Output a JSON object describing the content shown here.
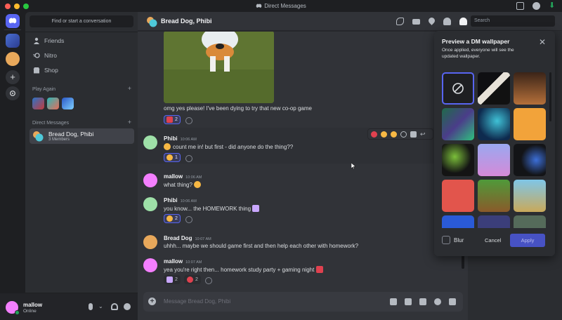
{
  "titlebar": {
    "title": "Direct Messages"
  },
  "sidebar": {
    "find_placeholder": "Find or start a conversation",
    "nav": [
      {
        "label": "Friends",
        "icon": "friends-icon"
      },
      {
        "label": "Nitro",
        "icon": "nitro-icon"
      },
      {
        "label": "Shop",
        "icon": "shop-icon"
      }
    ],
    "play_again_label": "Play Again",
    "direct_messages_label": "Direct Messages",
    "dm": {
      "name": "Bread Dog, Phibi",
      "subtitle": "3 Members"
    }
  },
  "user": {
    "name": "mallow",
    "status": "Online"
  },
  "header": {
    "title": "Bread Dog, Phibi",
    "search_placeholder": "Search"
  },
  "messages": [
    {
      "text": "omg yes please! I've been dying to try that new co-op game",
      "reactions": [
        {
          "emoji": "heart",
          "count": "2"
        }
      ]
    },
    {
      "author": "Phibi",
      "time": "10:06 AM",
      "text": "count me in! but first - did anyone do the thing??",
      "reactions": [
        {
          "emoji": "thinking",
          "count": "1"
        }
      ]
    },
    {
      "author": "mallow",
      "time": "10:06 AM",
      "text": "what thing?"
    },
    {
      "author": "Phibi",
      "time": "10:06 AM",
      "text": "you know... the HOMEWORK thing",
      "reactions": [
        {
          "emoji": "cry",
          "count": "2"
        }
      ]
    },
    {
      "author": "Bread Dog",
      "time": "10:07 AM",
      "text": "uhhh... maybe we should game first and then help each other with homework?"
    },
    {
      "author": "mallow",
      "time": "10:07 AM",
      "text": "yea you're right then... homework study party + gaming night",
      "reactions": [
        {
          "emoji": "books",
          "count": "2"
        },
        {
          "emoji": "pushpin",
          "count": "2"
        }
      ]
    }
  ],
  "composer": {
    "placeholder": "Message Bread Dog, Phibi"
  },
  "wallpaper": {
    "title": "Preview a DM wallpaper",
    "description": "Once applied, everyone will see the updated wallpaper.",
    "blur_label": "Blur",
    "cancel_label": "Cancel",
    "apply_label": "Apply"
  },
  "colors": {
    "accent": "#5865f2",
    "online": "#23a55a",
    "bg": "#313338"
  }
}
